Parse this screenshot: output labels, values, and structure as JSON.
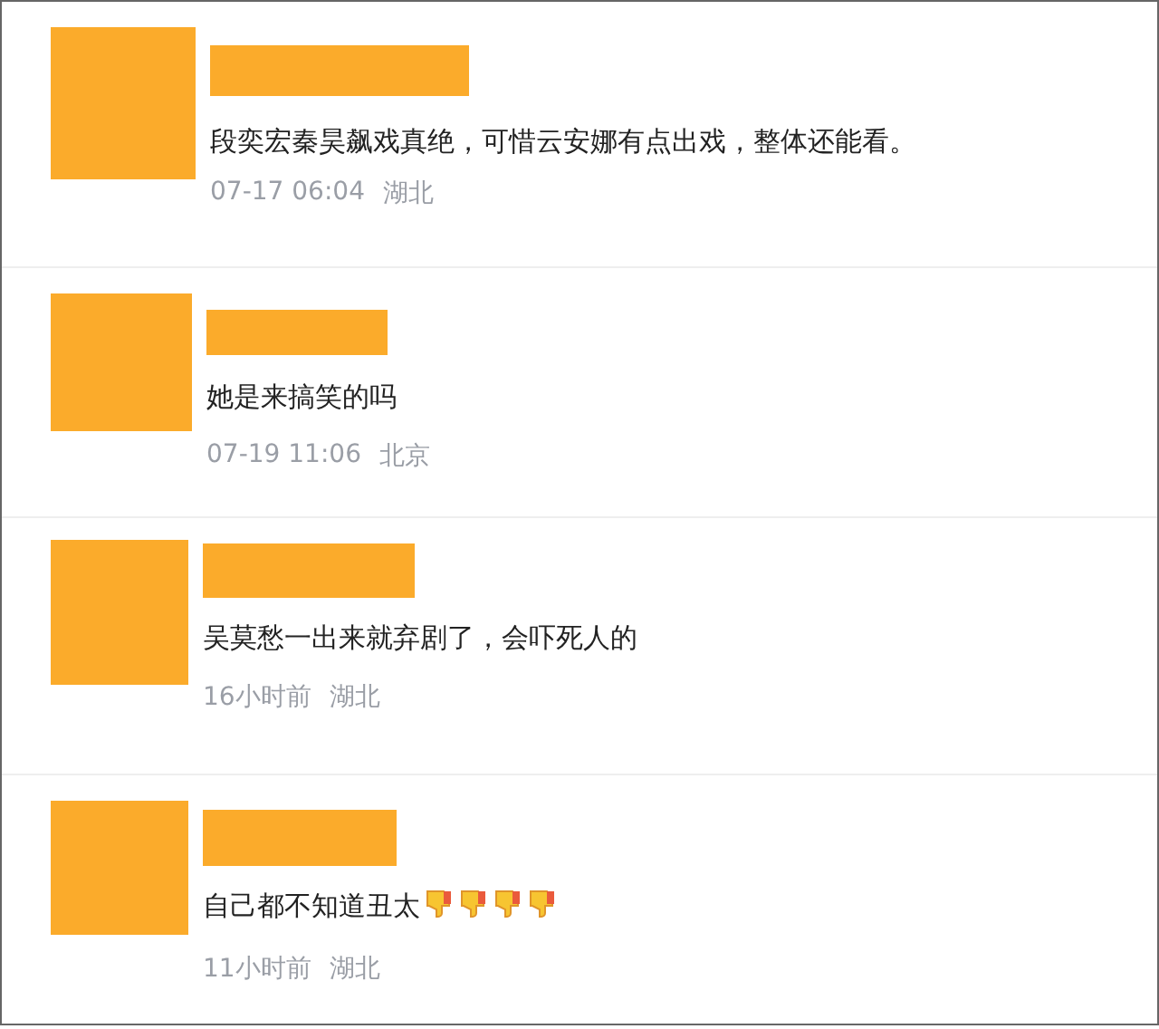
{
  "comments": [
    {
      "text": "段奕宏秦昊飙戏真绝，可惜云安娜有点出戏，整体还能看。",
      "time": "07-17 06:04",
      "location": "湖北"
    },
    {
      "text": "她是来搞笑的吗",
      "time": "07-19 11:06",
      "location": "北京"
    },
    {
      "text": "吴莫愁一出来就弃剧了，会吓死人的",
      "time": "16小时前",
      "location": "湖北"
    },
    {
      "text": "自己都不知道丑太",
      "time": "11小时前",
      "location": "湖北",
      "emojis": [
        {
          "kind": "thumbs-down"
        },
        {
          "kind": "thumbs-down"
        },
        {
          "kind": "thumbs-down"
        },
        {
          "kind": "thumbs-down"
        }
      ]
    }
  ]
}
